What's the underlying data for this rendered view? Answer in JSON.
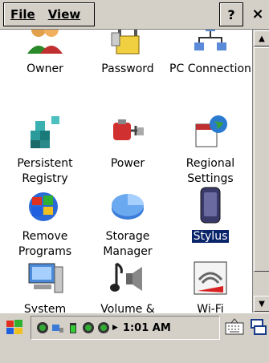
{
  "menu": {
    "file_label": "File",
    "view_label": "View",
    "help_label": "?",
    "close_label": "×"
  },
  "items": [
    {
      "label": "Owner",
      "icon": "owner-icon"
    },
    {
      "label": "Password",
      "icon": "password-icon"
    },
    {
      "label": "PC Connection",
      "icon": "pc-connection-icon"
    },
    {
      "label": "Persistent Registry",
      "icon": "persistent-registry-icon"
    },
    {
      "label": "Power",
      "icon": "power-icon"
    },
    {
      "label": "Regional Settings",
      "icon": "regional-settings-icon"
    },
    {
      "label": "Remove Programs",
      "icon": "remove-programs-icon"
    },
    {
      "label": "Storage Manager",
      "icon": "storage-manager-icon"
    },
    {
      "label": "Stylus",
      "icon": "stylus-icon",
      "selected": true
    },
    {
      "label": "System",
      "icon": "system-icon"
    },
    {
      "label": "Volume & Sounds",
      "icon": "volume-sounds-icon"
    },
    {
      "label": "Wi-Fi",
      "icon": "wifi-icon"
    }
  ],
  "taskbar": {
    "clock": "1:01 AM"
  },
  "colors": {
    "selection": "#0a246a",
    "chrome": "#d4d0c8"
  }
}
